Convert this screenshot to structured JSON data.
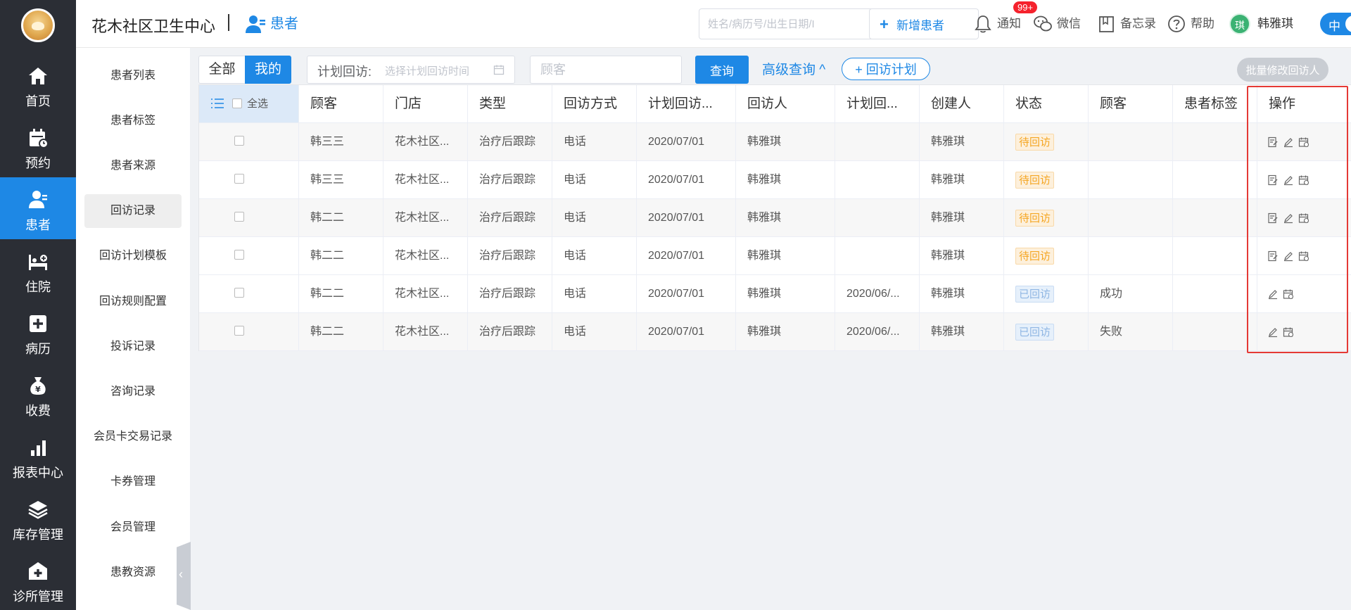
{
  "header": {
    "brand": "花木社区卫生中心",
    "crumb": "患者",
    "search_placeholder": "姓名/病历号/出生日期/I",
    "add_patient": "新增患者",
    "notify_label": "通知",
    "notify_badge": "99+",
    "wechat_label": "微信",
    "memo_label": "备忘录",
    "help_label": "帮助",
    "user_avatar_text": "琪",
    "user_name": "韩雅琪",
    "lang_toggle": "中"
  },
  "sidebar": {
    "items": [
      {
        "label": "首页",
        "icon": "home-icon"
      },
      {
        "label": "预约",
        "icon": "calendar-icon"
      },
      {
        "label": "患者",
        "icon": "patient-icon"
      },
      {
        "label": "住院",
        "icon": "bed-icon"
      },
      {
        "label": "病历",
        "icon": "medical-record-icon"
      },
      {
        "label": "收费",
        "icon": "money-bag-icon"
      },
      {
        "label": "报表中心",
        "icon": "bar-chart-icon"
      },
      {
        "label": "库存管理",
        "icon": "stack-icon"
      },
      {
        "label": "诊所管理",
        "icon": "clinic-icon"
      }
    ]
  },
  "submenu": {
    "items": [
      "患者列表",
      "患者标签",
      "患者来源",
      "回访记录",
      "回访计划模板",
      "回访规则配置",
      "投诉记录",
      "咨询记录",
      "会员卡交易记录",
      "卡券管理",
      "会员管理",
      "患教资源"
    ]
  },
  "filters": {
    "seg_all": "全部",
    "seg_mine": "我的",
    "date_label": "计划回访:",
    "date_placeholder": "选择计划回访时间",
    "customer_placeholder": "顾客",
    "query": "查询",
    "advanced": "高级查询 ^",
    "plan": "+ 回访计划",
    "batch": "批量修改回访人"
  },
  "table": {
    "select_all": "全选",
    "columns": [
      "顾客",
      "门店",
      "类型",
      "回访方式",
      "计划回访...",
      "回访人",
      "计划回...",
      "创建人",
      "状态",
      "顾客",
      "患者标签",
      "操作"
    ],
    "rows": [
      {
        "customer": "韩三三",
        "store": "花木社区...",
        "type": "治疗后跟踪",
        "method": "电话",
        "plan_date": "2020/07/01",
        "visitor": "韩雅琪",
        "plan2": "",
        "creator": "韩雅琪",
        "status": "待回访",
        "result": "",
        "tags": ""
      },
      {
        "customer": "韩三三",
        "store": "花木社区...",
        "type": "治疗后跟踪",
        "method": "电话",
        "plan_date": "2020/07/01",
        "visitor": "韩雅琪",
        "plan2": "",
        "creator": "韩雅琪",
        "status": "待回访",
        "result": "",
        "tags": ""
      },
      {
        "customer": "韩二二",
        "store": "花木社区...",
        "type": "治疗后跟踪",
        "method": "电话",
        "plan_date": "2020/07/01",
        "visitor": "韩雅琪",
        "plan2": "",
        "creator": "韩雅琪",
        "status": "待回访",
        "result": "",
        "tags": ""
      },
      {
        "customer": "韩二二",
        "store": "花木社区...",
        "type": "治疗后跟踪",
        "method": "电话",
        "plan_date": "2020/07/01",
        "visitor": "韩雅琪",
        "plan2": "",
        "creator": "韩雅琪",
        "status": "待回访",
        "result": "",
        "tags": ""
      },
      {
        "customer": "韩二二",
        "store": "花木社区...",
        "type": "治疗后跟踪",
        "method": "电话",
        "plan_date": "2020/07/01",
        "visitor": "韩雅琪",
        "plan2": "2020/06/...",
        "creator": "韩雅琪",
        "status": "已回访",
        "result": "成功",
        "tags": ""
      },
      {
        "customer": "韩二二",
        "store": "花木社区...",
        "type": "治疗后跟踪",
        "method": "电话",
        "plan_date": "2020/07/01",
        "visitor": "韩雅琪",
        "plan2": "2020/06/...",
        "creator": "韩雅琪",
        "status": "已回访",
        "result": "失败",
        "tags": ""
      }
    ]
  },
  "colors": {
    "primary": "#1e88e5",
    "sidebar_bg": "#2b2e35",
    "pending": "#f5a623",
    "done": "#8fb6e3",
    "highlight": "#e53935"
  }
}
